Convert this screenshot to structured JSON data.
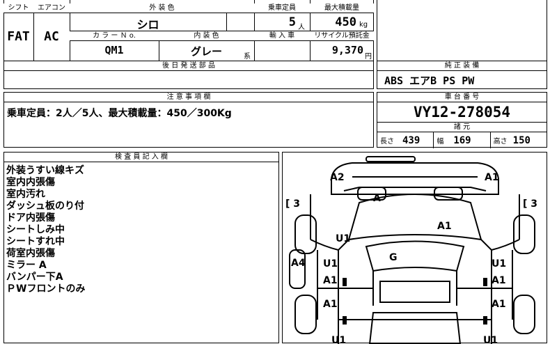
{
  "spec": {
    "shift_h": "シフト",
    "ac_h": "エアコン",
    "exterior_h": "外 装 色",
    "capacity_h": "乗車定員",
    "maxload_h": "最大積載量",
    "shift": "FAT",
    "ac": "AC",
    "exterior": "シロ",
    "capacity": "5",
    "capacity_unit": "人",
    "maxload": "450",
    "maxload_unit": "kg",
    "colorno_h": "カ ラ ー Ｎ o.",
    "interior_h": "内 装 色",
    "import_h": "輸 入 車",
    "recycle_h": "リサイクル預託金",
    "colorno": "QM1",
    "interior": "グレー",
    "interior_suffix": "系",
    "recycle": "9,370",
    "recycle_unit": "円",
    "deferred_h": "後 日 発 送 部 品"
  },
  "equip": {
    "header": "純 正 装 備",
    "value": "ABS エアB PS PW"
  },
  "notes": {
    "header": "注 意 事 項 欄",
    "text": "乗車定員：2人／5人、最大積載量：450／300Kg"
  },
  "chassis": {
    "header": "車 台 番 号",
    "value": "VY12-278054",
    "specs_header": "諸 元",
    "length_l": "長さ",
    "length": "439",
    "width_l": "幅",
    "width": "169",
    "height_l": "高さ",
    "height": "150"
  },
  "inspector": {
    "header": "検 査 員 記 入 欄",
    "lines": [
      "外装うすい線キズ",
      "室内内張傷",
      "室内汚れ",
      "ダッシュ板のり付",
      "ドア内張傷",
      "シートしみ中",
      "シートすれ中",
      "荷室内張傷",
      "ミラー A",
      "バンパー下A",
      "ＰWフロントのみ"
    ]
  },
  "diagram": {
    "labels": {
      "a2": "A2",
      "a1_top": "A1",
      "a_mid": "A",
      "bracket_l": "[ 3",
      "bracket_r": "[ 3",
      "a1_hood": "A1",
      "u1_l": "U1",
      "g": "G",
      "a4": "A4",
      "u1_ld": "U1",
      "a1_ld": "A1",
      "u1_rd": "U1",
      "a1_rd": "A1",
      "a1_lr": "A1",
      "a1_rr": "A1",
      "u1_bl": "U1",
      "u1_br": "U1"
    }
  }
}
